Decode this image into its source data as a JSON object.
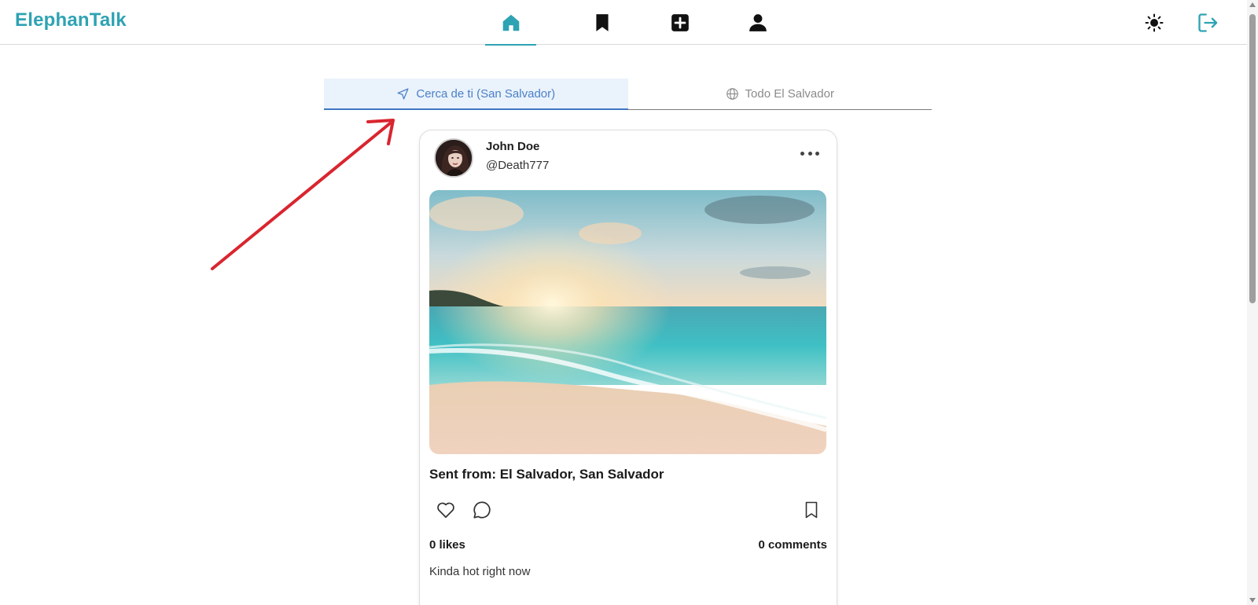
{
  "app": {
    "brand": "ElephanTalk",
    "accent": "#2ea3b3"
  },
  "nav": {
    "items": [
      {
        "name": "home",
        "icon": "home-icon",
        "active": true
      },
      {
        "name": "saved",
        "icon": "bookmark-icon",
        "active": false
      },
      {
        "name": "create",
        "icon": "plus-square-icon",
        "active": false
      },
      {
        "name": "profile",
        "icon": "user-icon",
        "active": false
      }
    ]
  },
  "top_actions": [
    {
      "name": "theme-toggle",
      "icon": "sun-icon"
    },
    {
      "name": "logout",
      "icon": "logout-icon"
    }
  ],
  "tabs": [
    {
      "label": "Cerca de ti (San Salvador)",
      "icon": "navigation-arrow-icon",
      "active": true
    },
    {
      "label": "Todo El Salvador",
      "icon": "globe-icon",
      "active": false
    }
  ],
  "post": {
    "user_name": "John Doe",
    "user_handle": "@Death777",
    "title": "Sent from: El Salvador, San Salvador",
    "likes": "0 likes",
    "comments": "0 comments",
    "caption": "Kinda hot right now"
  },
  "annotation": {
    "type": "red-arrow",
    "color": "#d9252f"
  }
}
